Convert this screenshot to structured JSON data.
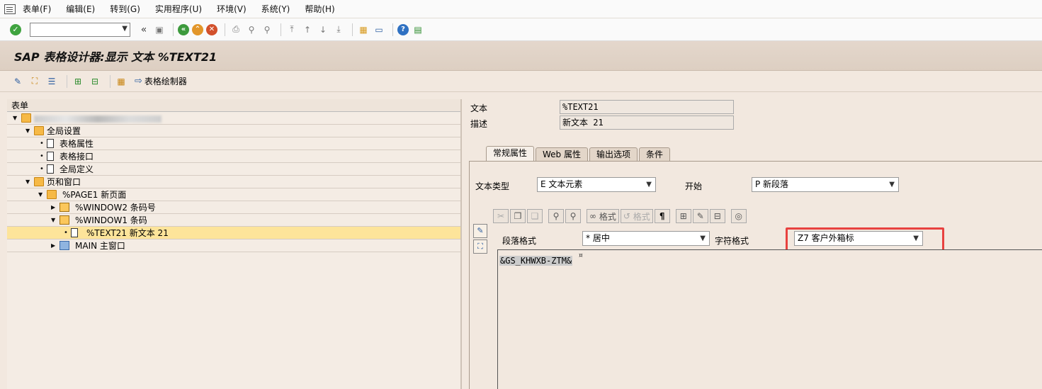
{
  "menu": {
    "items": [
      "表单(F)",
      "编辑(E)",
      "转到(G)",
      "实用程序(U)",
      "环境(V)",
      "系统(Y)",
      "帮助(H)"
    ]
  },
  "toolbar": {
    "command_field_value": ""
  },
  "title": "SAP 表格设计器:显示 文本 %TEXT21",
  "app_toolbar": {
    "form_painter_label": "表格绘制器"
  },
  "tree": {
    "header": "表单",
    "rows": {
      "root": "",
      "global_settings": "全局设置",
      "form_attributes": "表格属性",
      "form_interface": "表格接口",
      "global_definitions": "全局定义",
      "pages_windows": "页和窗口",
      "page1": "%PAGE1 新页面",
      "window2": "%WINDOW2 条码号",
      "window1": "%WINDOW1 条码",
      "text21": "%TEXT21 新文本 21",
      "main": "MAIN 主窗口"
    }
  },
  "detail": {
    "text_label": "文本",
    "text_value": "%TEXT21",
    "desc_label": "描述",
    "desc_value": "新文本 21",
    "tabs": [
      "常规属性",
      "Web 属性",
      "输出选项",
      "条件"
    ],
    "text_type_label": "文本类型",
    "text_type_value": "E 文本元素",
    "start_label": "开始",
    "start_value": "P 新段落",
    "format_button_label": "格式",
    "format_button2_label": "格式",
    "para_format_label": "段落格式",
    "para_format_value": "* 居中",
    "char_format_label": "字符格式",
    "char_format_value": "Z7 客户外箱标",
    "editor_text": "&GS_KHWXB-ZTM&",
    "editor_mark": "¤"
  },
  "colors": {
    "highlight": "#e8413f",
    "selected_row": "#fde49a"
  }
}
